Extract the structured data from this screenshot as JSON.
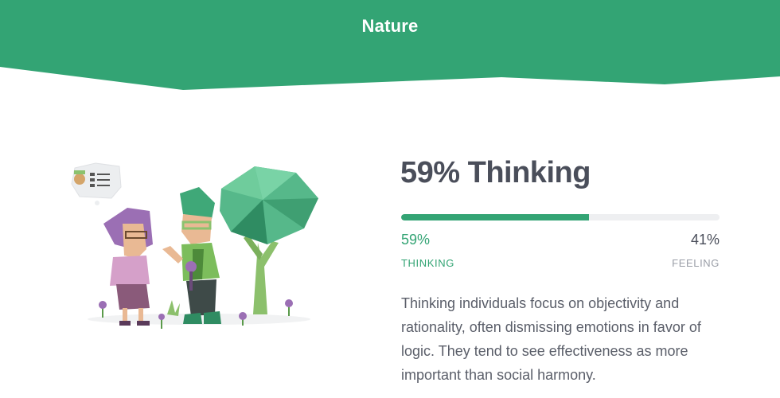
{
  "header": {
    "title": "Nature"
  },
  "trait": {
    "heading": "59% Thinking",
    "left_percent_text": "59%",
    "right_percent_text": "41%",
    "left_label": "THINKING",
    "right_label": "FEELING",
    "left_fraction": 0.59,
    "description": "Thinking individuals focus on objectivity and rationality, often dismissing emotions in favor of logic. They tend to see effectiveness as more important than social harmony."
  },
  "colors": {
    "accent": "#33a474",
    "heading_text": "#4a4e5a",
    "muted": "#9a9ea7",
    "track": "#eeeff1"
  },
  "illustration": {
    "icon": "nature-thinking-illustration"
  }
}
